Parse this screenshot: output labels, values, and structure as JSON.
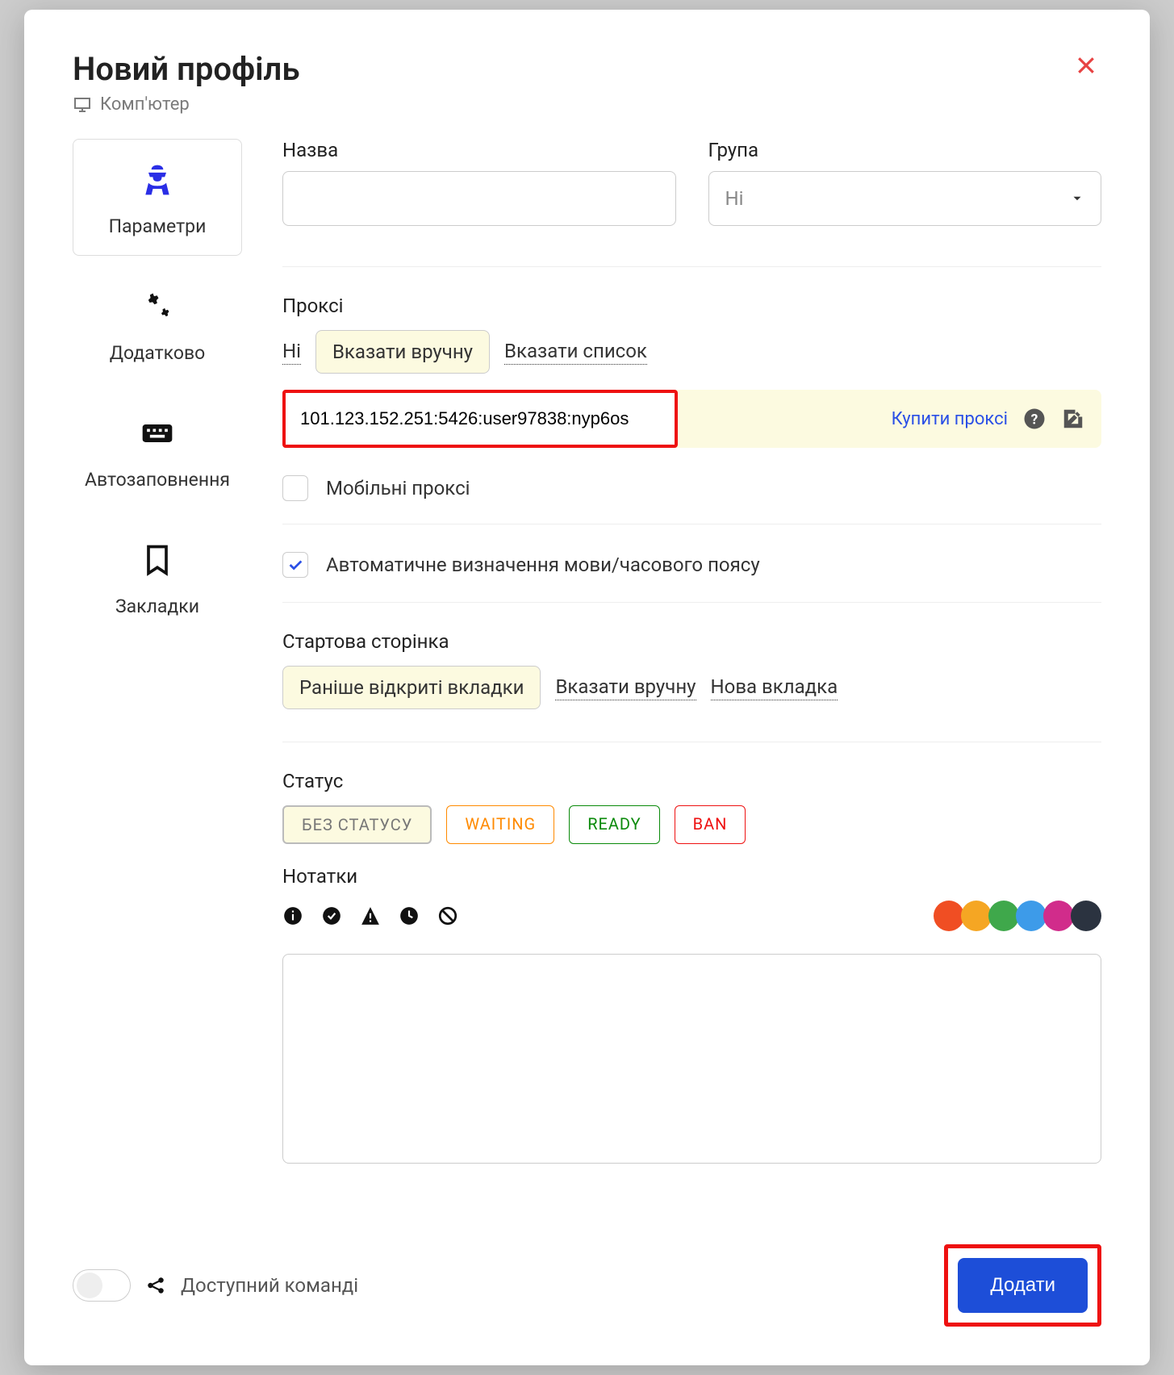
{
  "header": {
    "title": "Новий профіль",
    "device": "Комп'ютер"
  },
  "sidebar": {
    "items": [
      {
        "label": "Параметри"
      },
      {
        "label": "Додатково"
      },
      {
        "label": "Автозаповнення"
      },
      {
        "label": "Закладки"
      }
    ]
  },
  "name": {
    "label": "Назва",
    "value": ""
  },
  "group": {
    "label": "Група",
    "selected": "Ні"
  },
  "proxy": {
    "label": "Проксі",
    "tabs": {
      "none": "Ні",
      "manual": "Вказати вручну",
      "list": "Вказати список"
    },
    "value": "101.123.152.251:5426:user97838:nyp6os",
    "buy": "Купити проксі",
    "mobile_label": "Мобільні проксі",
    "auto_label": "Автоматичне визначення мови/часового поясу"
  },
  "startpage": {
    "label": "Стартова сторінка",
    "tabs": {
      "previous": "Раніше відкриті вкладки",
      "manual": "Вказати вручну",
      "newtab": "Нова вкладка"
    }
  },
  "status": {
    "label": "Статус",
    "none": "БЕЗ СТАТУСУ",
    "waiting": "WAITING",
    "ready": "READY",
    "ban": "BAN"
  },
  "notes": {
    "label": "Нотатки",
    "colors": [
      "#f04e23",
      "#f5a623",
      "#3fa84b",
      "#3d9be9",
      "#d12c8b",
      "#2b3340"
    ]
  },
  "footer": {
    "team_label": "Доступний команді",
    "add": "Додати"
  }
}
